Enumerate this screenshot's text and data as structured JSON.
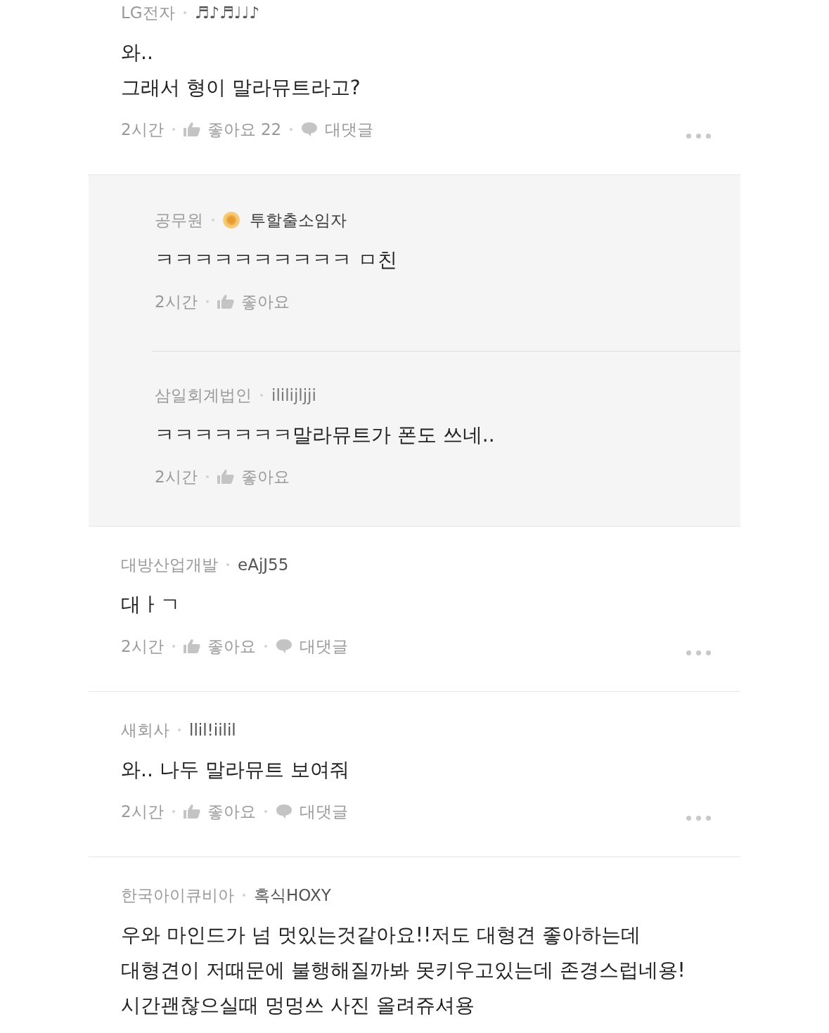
{
  "comments": [
    {
      "company": "LG전자",
      "nickname": "♬♪♬♩♩♪",
      "body": [
        "와..",
        "그래서 형이 말라뮤트라고?"
      ],
      "time": "2시간",
      "like_label": "좋아요",
      "like_count": "22",
      "reply_label": "대댓글",
      "replies": [
        {
          "company": "공무원",
          "badge": true,
          "nickname": "투할출소임자",
          "body": [
            "ㅋㅋㅋㅋㅋㅋㅋㅋㅋㅋ ㅁ친"
          ],
          "time": "2시간",
          "like_label": "좋아요"
        },
        {
          "company": "삼일회계법인",
          "badge": false,
          "nickname": "ililijljji",
          "body": [
            "ㅋㅋㅋㅋㅋㅋㅋ말라뮤트가 폰도 쓰네.."
          ],
          "time": "2시간",
          "like_label": "좋아요"
        }
      ]
    },
    {
      "company": "대방산업개발",
      "nickname": "eAjJ55",
      "body": [
        "대ㅏㄱ"
      ],
      "time": "2시간",
      "like_label": "좋아요",
      "reply_label": "대댓글"
    },
    {
      "company": "새회사",
      "nickname": "llil!iilil",
      "body": [
        "와.. 나두 말라뮤트 보여줘"
      ],
      "time": "2시간",
      "like_label": "좋아요",
      "reply_label": "대댓글"
    },
    {
      "company": "한국아이큐비아",
      "nickname": "혹식HOXY",
      "body": [
        "우와 마인드가 넘 멋있는것같아요!!저도 대형견 좋아하는데",
        "대형견이 저때문에 불행해질까봐 못키우고있는데 존경스럽네용!",
        "시간괜찮으실때 멍멍쓰 사진 올려쥬셔용"
      ]
    }
  ]
}
